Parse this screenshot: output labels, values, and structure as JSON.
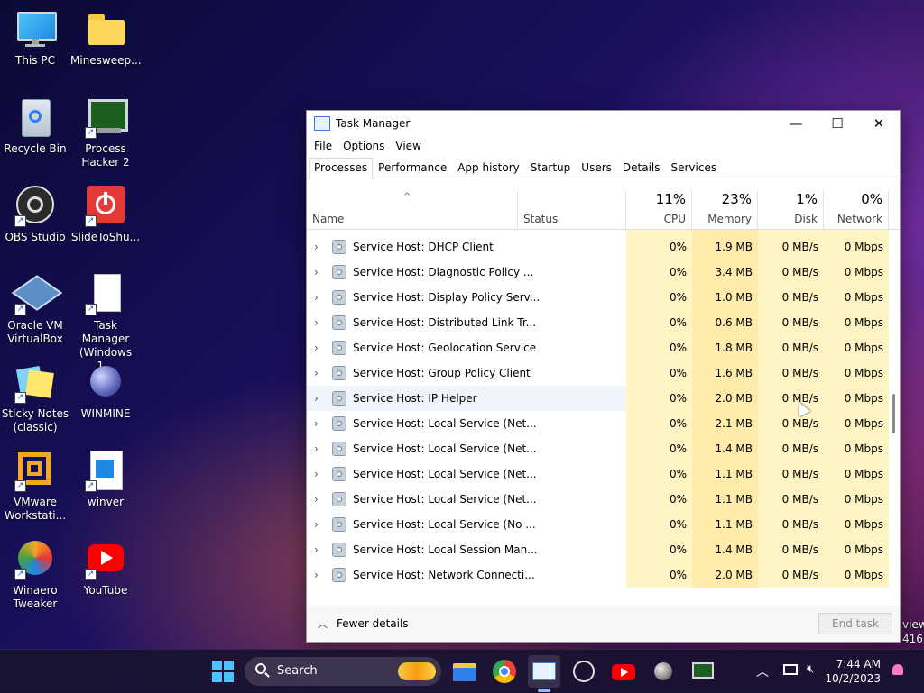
{
  "desktop": {
    "icons": [
      {
        "label": "This PC"
      },
      {
        "label": "Minesweep..."
      },
      {
        "label": "Recycle Bin"
      },
      {
        "label": "Process Hacker 2"
      },
      {
        "label": "OBS Studio"
      },
      {
        "label": "SlideToShu..."
      },
      {
        "label": "Oracle VM VirtualBox"
      },
      {
        "label": "Task Manager (Windows 1..."
      },
      {
        "label": "Sticky Notes (classic)"
      },
      {
        "label": "WINMINE"
      },
      {
        "label": "VMware Workstati..."
      },
      {
        "label": "winver"
      },
      {
        "label": "Winaero Tweaker"
      },
      {
        "label": "YouTube"
      }
    ],
    "bg_text_1": "view",
    "bg_text_2": "416"
  },
  "window": {
    "title": "Task Manager",
    "minimize_glyph": "—",
    "maximize_glyph": "☐",
    "close_glyph": "✕",
    "menu": [
      "File",
      "Options",
      "View"
    ],
    "tabs": [
      "Processes",
      "Performance",
      "App history",
      "Startup",
      "Users",
      "Details",
      "Services"
    ],
    "active_tab": "Processes"
  },
  "columns": {
    "name": "Name",
    "status": "Status",
    "cpu": {
      "pct": "11%",
      "label": "CPU"
    },
    "memory": {
      "pct": "23%",
      "label": "Memory"
    },
    "disk": {
      "pct": "1%",
      "label": "Disk"
    },
    "network": {
      "pct": "0%",
      "label": "Network"
    },
    "sort_arrow": "^"
  },
  "processes": [
    {
      "name": "Service Host: DHCP Client",
      "cpu": "0%",
      "memory": "1.9 MB",
      "disk": "0 MB/s",
      "network": "0 Mbps"
    },
    {
      "name": "Service Host: Diagnostic Policy ...",
      "cpu": "0%",
      "memory": "3.4 MB",
      "disk": "0 MB/s",
      "network": "0 Mbps"
    },
    {
      "name": "Service Host: Display Policy Serv...",
      "cpu": "0%",
      "memory": "1.0 MB",
      "disk": "0 MB/s",
      "network": "0 Mbps"
    },
    {
      "name": "Service Host: Distributed Link Tr...",
      "cpu": "0%",
      "memory": "0.6 MB",
      "disk": "0 MB/s",
      "network": "0 Mbps"
    },
    {
      "name": "Service Host: Geolocation Service",
      "cpu": "0%",
      "memory": "1.8 MB",
      "disk": "0 MB/s",
      "network": "0 Mbps"
    },
    {
      "name": "Service Host: Group Policy Client",
      "cpu": "0%",
      "memory": "1.6 MB",
      "disk": "0 MB/s",
      "network": "0 Mbps"
    },
    {
      "name": "Service Host: IP Helper",
      "cpu": "0%",
      "memory": "2.0 MB",
      "disk": "0 MB/s",
      "network": "0 Mbps"
    },
    {
      "name": "Service Host: Local Service (Net...",
      "cpu": "0%",
      "memory": "2.1 MB",
      "disk": "0 MB/s",
      "network": "0 Mbps"
    },
    {
      "name": "Service Host: Local Service (Net...",
      "cpu": "0%",
      "memory": "1.4 MB",
      "disk": "0 MB/s",
      "network": "0 Mbps"
    },
    {
      "name": "Service Host: Local Service (Net...",
      "cpu": "0%",
      "memory": "1.1 MB",
      "disk": "0 MB/s",
      "network": "0 Mbps"
    },
    {
      "name": "Service Host: Local Service (Net...",
      "cpu": "0%",
      "memory": "1.1 MB",
      "disk": "0 MB/s",
      "network": "0 Mbps"
    },
    {
      "name": "Service Host: Local Service (No ...",
      "cpu": "0%",
      "memory": "1.1 MB",
      "disk": "0 MB/s",
      "network": "0 Mbps"
    },
    {
      "name": "Service Host: Local Session Man...",
      "cpu": "0%",
      "memory": "1.4 MB",
      "disk": "0 MB/s",
      "network": "0 Mbps"
    },
    {
      "name": "Service Host: Network Connecti...",
      "cpu": "0%",
      "memory": "2.0 MB",
      "disk": "0 MB/s",
      "network": "0 Mbps"
    }
  ],
  "footer": {
    "fewer_details": "Fewer details",
    "end_task": "End task"
  },
  "taskbar": {
    "search_label": "Search",
    "time": "7:44 AM",
    "date": "10/2/2023"
  },
  "colors": {
    "cpu_bg": "#fff4c4",
    "memory_bg": "#ffecab",
    "selected_row": "#f0f5fb"
  }
}
